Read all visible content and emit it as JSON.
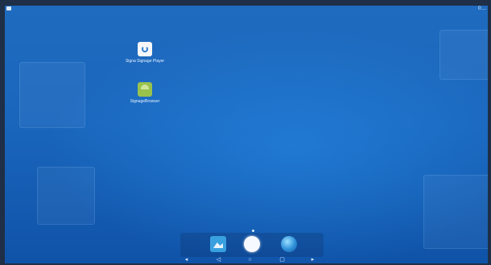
{
  "status_bar": {
    "right_text": "0:..."
  },
  "desktop_icons": [
    {
      "label": "Signa Signage Player",
      "icon": "signage-player-icon"
    },
    {
      "label": "SignageBrowser",
      "icon": "android-app-icon"
    }
  ],
  "dock": [
    {
      "icon": "gallery-icon"
    },
    {
      "icon": "all-apps-icon"
    },
    {
      "icon": "browser-globe-icon"
    }
  ],
  "nav_bar": [
    {
      "icon": "volume-down-icon",
      "glyph": "◂"
    },
    {
      "icon": "back-icon",
      "glyph": "◁"
    },
    {
      "icon": "home-icon",
      "glyph": "○"
    },
    {
      "icon": "recents-icon",
      "glyph": "▢"
    },
    {
      "icon": "volume-up-icon",
      "glyph": "▸"
    }
  ],
  "colors": {
    "wallpaper": "#1a66bd",
    "dock_tint": "#0a285a"
  }
}
